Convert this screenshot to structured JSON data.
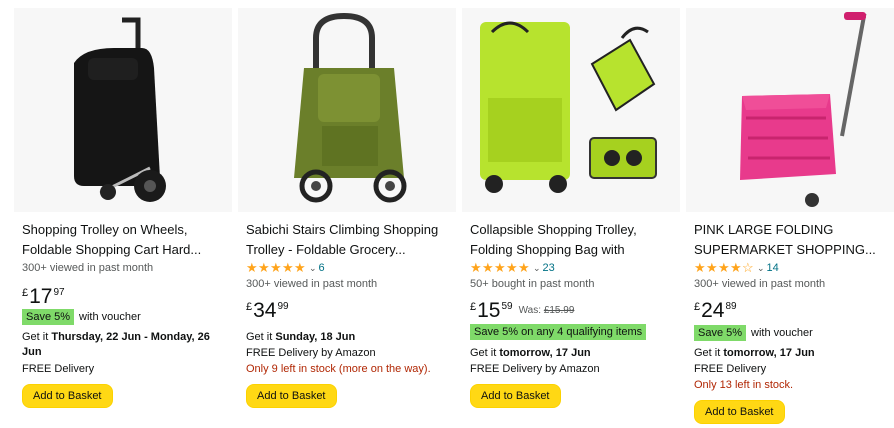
{
  "products": [
    {
      "title": "Shopping Trolley on Wheels, Foldable Shopping Cart Hard...",
      "social": "300+ viewed in past month",
      "price": {
        "currency": "£",
        "whole": "17",
        "fraction": "97"
      },
      "save": "Save 5%",
      "save_extra": "with voucher",
      "delivery_prefix": "Get it",
      "delivery_date": "Thursday, 22 Jun - Monday, 26 Jun",
      "free_delivery": "FREE Delivery",
      "button": "Add to Basket",
      "image_icon": "black-shopping-trolley"
    },
    {
      "title": "Sabichi Stairs Climbing Shopping Trolley - Foldable Grocery...",
      "rating": 4.5,
      "rating_count": "6",
      "social": "300+ viewed in past month",
      "price": {
        "currency": "£",
        "whole": "34",
        "fraction": "99"
      },
      "delivery_prefix": "Get it",
      "delivery_date": "Sunday, 18 Jun",
      "free_delivery": "FREE Delivery by Amazon",
      "stock": "Only 9 left in stock (more on the way).",
      "button": "Add to Basket",
      "image_icon": "green-stair-climbing-trolley"
    },
    {
      "title": "Collapsible Shopping Trolley, Folding Shopping Bag with Rubbe...",
      "rating": 4.5,
      "rating_count": "23",
      "social": "50+ bought in past month",
      "price": {
        "currency": "£",
        "whole": "15",
        "fraction": "59"
      },
      "was_label": "Was:",
      "was_price": "£15.99",
      "save": "Save 5% on any 4 qualifying items",
      "delivery_prefix": "Get it",
      "delivery_date": "tomorrow, 17 Jun",
      "free_delivery": "FREE Delivery by Amazon",
      "button": "Add to Basket",
      "image_icon": "lime-collapsible-trolley"
    },
    {
      "title": "PINK LARGE FOLDING SUPERMARKET SHOPPING...",
      "rating": 4,
      "rating_count": "14",
      "social": "300+ viewed in past month",
      "price": {
        "currency": "£",
        "whole": "24",
        "fraction": "89"
      },
      "save": "Save 5%",
      "save_extra": "with voucher",
      "delivery_prefix": "Get it",
      "delivery_date": "tomorrow, 17 Jun",
      "free_delivery": "FREE Delivery",
      "stock": "Only 13 left in stock.",
      "button": "Add to Basket",
      "image_icon": "pink-folding-crate-trolley"
    }
  ],
  "colors": {
    "star": "#FFA41C",
    "save_badge": "#7FDA69",
    "button": "#FFD814",
    "stock": "#B12704",
    "link": "#007185"
  }
}
